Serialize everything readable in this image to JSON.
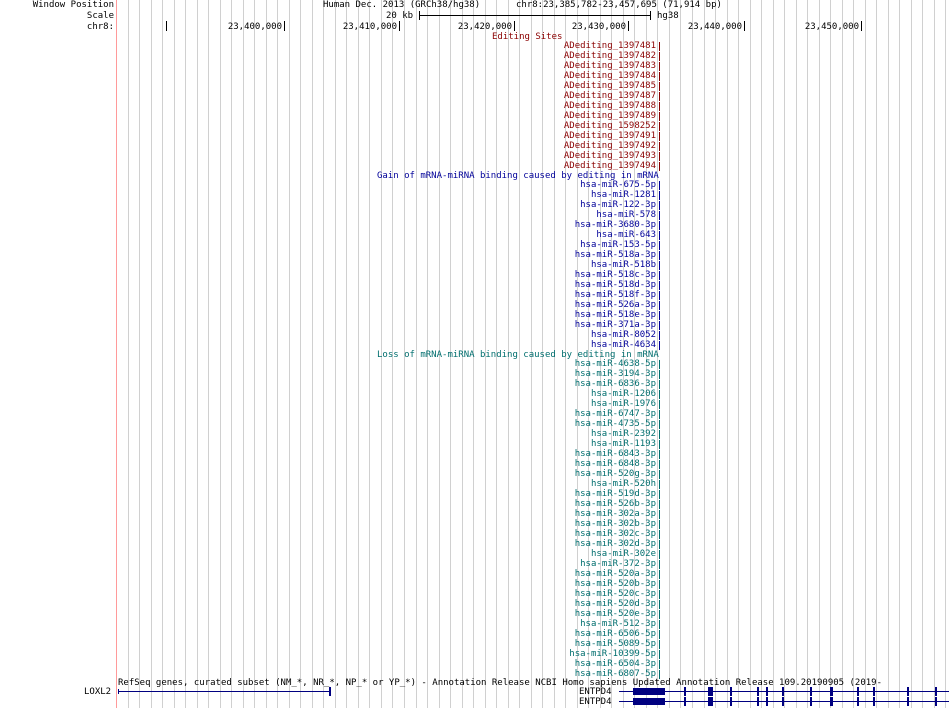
{
  "side_labels": {
    "window_position": "Window Position",
    "scale": "Scale",
    "chrom": "chr8:"
  },
  "header": {
    "assembly": "Human Dec. 2013 (GRCh38/hg38)",
    "position": "chr8:23,385,782-23,457,695 (71,914 bp)",
    "scale_text": "20 kb",
    "scale_assembly": "hg38"
  },
  "ruler_ticks": [
    "23,400,000",
    "23,410,000",
    "23,420,000",
    "23,430,000",
    "23,440,000",
    "23,450,000"
  ],
  "tracks": {
    "editing": {
      "title": "Editing Sites",
      "items": [
        "ADediting_1397481",
        "ADediting_1397482",
        "ADediting_1397483",
        "ADediting_1397484",
        "ADediting_1397485",
        "ADediting_1397487",
        "ADediting_1397488",
        "ADediting_1397489",
        "ADediting_1598252",
        "ADediting_1397491",
        "ADediting_1397492",
        "ADediting_1397493",
        "ADediting_1397494"
      ]
    },
    "gain": {
      "title": "Gain of mRNA-miRNA binding caused by editing in mRNA",
      "items": [
        "hsa-miR-675-5p",
        "hsa-miR-1281",
        "hsa-miR-122-3p",
        "hsa-miR-578",
        "hsa-miR-3680-3p",
        "hsa-miR-643",
        "hsa-miR-153-5p",
        "hsa-miR-518a-3p",
        "hsa-miR-518b",
        "hsa-miR-518c-3p",
        "hsa-miR-518d-3p",
        "hsa-miR-518f-3p",
        "hsa-miR-526a-3p",
        "hsa-miR-518e-3p",
        "hsa-miR-371a-3p",
        "hsa-miR-8052",
        "hsa-miR-4634"
      ]
    },
    "loss": {
      "title": "Loss of mRNA-miRNA binding caused by editing in mRNA",
      "items": [
        "hsa-miR-4638-5p",
        "hsa-miR-3194-3p",
        "hsa-miR-6836-3p",
        "hsa-miR-1206",
        "hsa-miR-1976",
        "hsa-miR-6747-3p",
        "hsa-miR-4735-5p",
        "hsa-miR-2392",
        "hsa-miR-1193",
        "hsa-miR-6843-3p",
        "hsa-miR-6848-3p",
        "hsa-miR-520g-3p",
        "hsa-miR-520h",
        "hsa-miR-519d-3p",
        "hsa-miR-526b-3p",
        "hsa-miR-302a-3p",
        "hsa-miR-302b-3p",
        "hsa-miR-302c-3p",
        "hsa-miR-302d-3p",
        "hsa-miR-302e",
        "hsa-miR-372-3p",
        "hsa-miR-520a-3p",
        "hsa-miR-520b-3p",
        "hsa-miR-520c-3p",
        "hsa-miR-520d-3p",
        "hsa-miR-520e-3p",
        "hsa-miR-512-3p",
        "hsa-miR-6506-5p",
        "hsa-miR-5089-5p",
        "hsa-miR-10399-5p",
        "hsa-miR-6504-3p",
        "hsa-miR-6807-5p"
      ]
    },
    "refseq": {
      "title": "RefSeq genes, curated subset (NM_*, NR_*, NP_* or YP_*) - Annotation Release NCBI Homo sapiens Updated Annotation Release 109.20190905 (2019-",
      "genes": [
        "LOXL2",
        "ENTPD4",
        "ENTPD4"
      ]
    }
  },
  "colors": {
    "editing": "#8b0000",
    "gain": "#000099",
    "loss": "#006e6e",
    "gene": "#000080",
    "guide": "#d0d0d0",
    "guide_red": "#ff9a9a"
  }
}
